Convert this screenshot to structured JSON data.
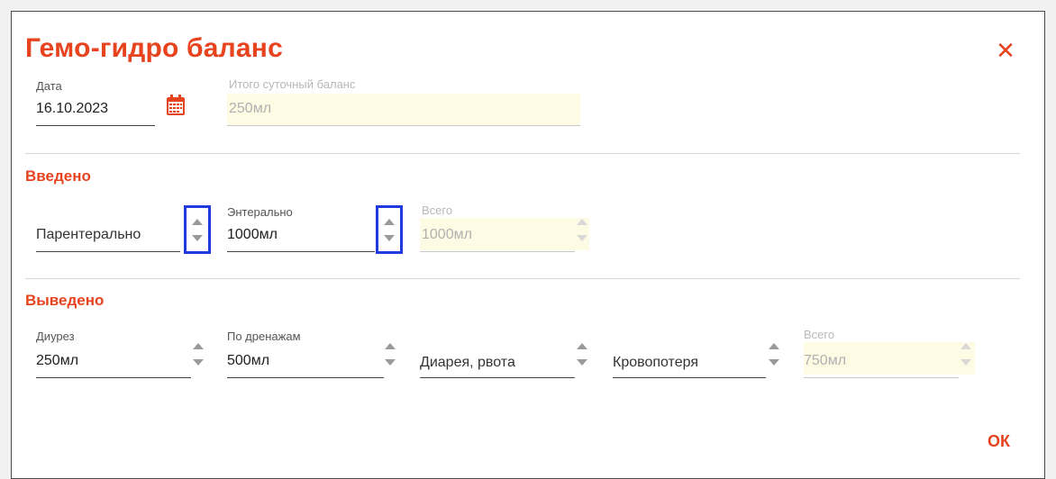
{
  "dialog": {
    "title": "Гемо-гидро баланс",
    "close_icon": "close-x-icon",
    "ok_label": "ОК"
  },
  "date_field": {
    "label": "Дата",
    "value": "16.10.2023",
    "icon": "calendar-icon"
  },
  "daily_balance": {
    "label": "Итого суточный баланс",
    "value": "250мл"
  },
  "input_section": {
    "title": "Введено",
    "parenteral": {
      "placeholder": "Парентерально",
      "value": ""
    },
    "enteral": {
      "label": "Энтерально",
      "value": "1000мл"
    },
    "total": {
      "label": "Всего",
      "value": "1000мл"
    }
  },
  "output_section": {
    "title": "Выведено",
    "diuresis": {
      "label": "Диурез",
      "value": "250мл"
    },
    "drainage": {
      "label": "По дренажам",
      "value": "500мл"
    },
    "diarrhea": {
      "placeholder": "Диарея, рвота",
      "value": ""
    },
    "blood_loss": {
      "placeholder": "Кровопотеря",
      "value": ""
    },
    "total": {
      "label": "Всего",
      "value": "750мл"
    }
  },
  "colors": {
    "accent": "#e8431f",
    "highlight": "#1f3adf",
    "disabled_bg": "#fefbe4"
  }
}
